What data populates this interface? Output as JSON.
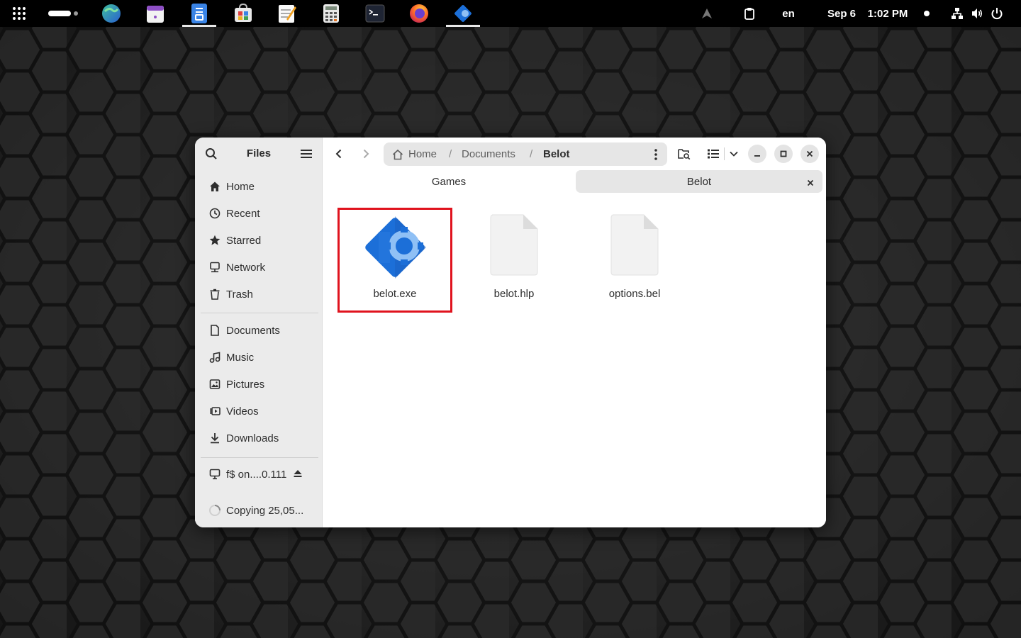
{
  "topbar": {
    "date": "Sep 6",
    "time": "1:02 PM",
    "language": "en",
    "apps": [
      "apps-grid-icon",
      "workspace-indicator",
      "globe-icon",
      "calendar-icon",
      "files-icon",
      "software-icon",
      "text-editor-icon",
      "calculator-icon",
      "terminal-icon",
      "firefox-icon",
      "belot-app-icon"
    ]
  },
  "window": {
    "title": "Files",
    "sidebar": {
      "places": [
        {
          "label": "Home",
          "icon": "home-icon"
        },
        {
          "label": "Recent",
          "icon": "clock-icon"
        },
        {
          "label": "Starred",
          "icon": "star-icon"
        },
        {
          "label": "Network",
          "icon": "network-icon"
        },
        {
          "label": "Trash",
          "icon": "trash-icon"
        }
      ],
      "bookmarks": [
        {
          "label": "Documents",
          "icon": "document-icon"
        },
        {
          "label": "Music",
          "icon": "music-icon"
        },
        {
          "label": "Pictures",
          "icon": "picture-icon"
        },
        {
          "label": "Videos",
          "icon": "video-icon"
        },
        {
          "label": "Downloads",
          "icon": "download-icon"
        }
      ],
      "mount": {
        "label": "f$ on....0.111",
        "icon": "network-drive-icon"
      },
      "operation": {
        "label": "Copying 25,05..."
      }
    },
    "pathbar": {
      "crumbs": [
        "Home",
        "Documents",
        "Belot"
      ]
    },
    "tabs": [
      {
        "label": "Games",
        "active": false
      },
      {
        "label": "Belot",
        "active": true
      }
    ],
    "files": [
      {
        "name": "belot.exe",
        "icon": "belot-executable-icon",
        "selected": true
      },
      {
        "name": "belot.hlp",
        "icon": "generic-file-icon",
        "selected": false
      },
      {
        "name": "options.bel",
        "icon": "generic-file-icon",
        "selected": false
      }
    ]
  },
  "colors": {
    "selection_outline": "#e0131e",
    "app_icon_blue": "#1c6fd8"
  }
}
